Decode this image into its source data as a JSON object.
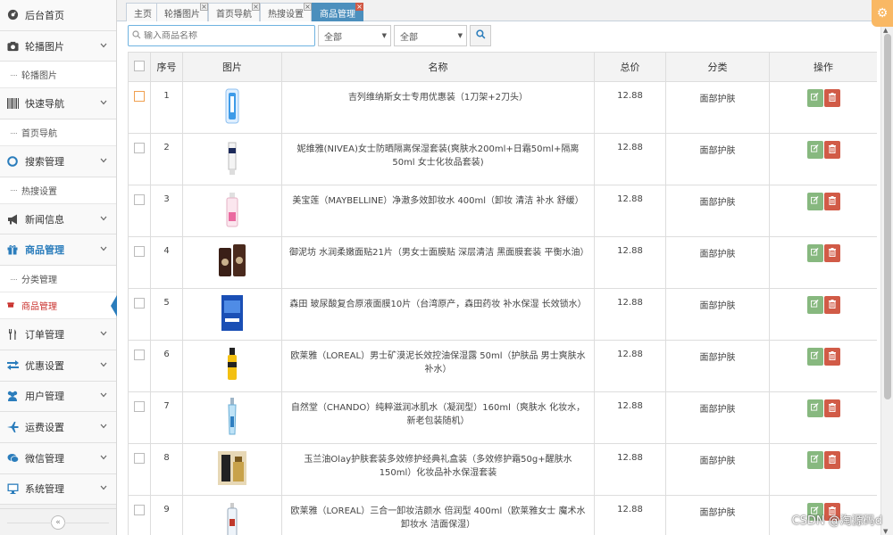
{
  "sidebar": {
    "items": [
      {
        "label": "后台首页",
        "icon": "dashboard-icon",
        "expandable": false
      },
      {
        "label": "轮播图片",
        "icon": "camera-icon",
        "expandable": true
      },
      {
        "sub": "轮播图片"
      },
      {
        "label": "快速导航",
        "icon": "barcode-icon",
        "expandable": true
      },
      {
        "sub": "首页导航"
      },
      {
        "label": "搜索管理",
        "icon": "circle-icon",
        "expandable": true
      },
      {
        "sub": "热搜设置"
      },
      {
        "label": "新闻信息",
        "icon": "megaphone-icon",
        "expandable": true
      },
      {
        "label": "商品管理",
        "icon": "gift-icon",
        "expandable": true,
        "active": true
      },
      {
        "sub": "分类管理"
      },
      {
        "sub": "商品管理",
        "active": true
      },
      {
        "label": "订单管理",
        "icon": "cutlery-icon",
        "expandable": true
      },
      {
        "label": "优惠设置",
        "icon": "exchange-icon",
        "expandable": true
      },
      {
        "label": "用户管理",
        "icon": "users-icon",
        "expandable": true
      },
      {
        "label": "运费设置",
        "icon": "plane-icon",
        "expandable": true
      },
      {
        "label": "微信管理",
        "icon": "chat-icon",
        "expandable": true
      },
      {
        "label": "系统管理",
        "icon": "monitor-icon",
        "expandable": true
      }
    ]
  },
  "tabs": [
    "主页",
    "轮播图片",
    "首页导航",
    "热搜设置",
    "商品管理"
  ],
  "toolbar": {
    "search_placeholder": "输入商品名称",
    "select1": "全部",
    "select2": "全部"
  },
  "table": {
    "headers": [
      "",
      "序号",
      "图片",
      "名称",
      "总价",
      "分类",
      "操作"
    ],
    "rows": [
      {
        "no": "1",
        "name": "吉列维纳斯女士专用优惠装（1刀架+2刀头）",
        "price": "12.88",
        "category": "面部护肤",
        "thumb": "razor"
      },
      {
        "no": "2",
        "name": "妮维雅(NIVEA)女士防晒隔离保湿套装(爽肤水200ml+日霜50ml+隔离50ml 女士化妆品套装)",
        "price": "12.88",
        "category": "面部护肤",
        "thumb": "tube"
      },
      {
        "no": "3",
        "name": "美宝莲（MAYBELLINE）净澈多效卸妆水 400ml（卸妆 清洁 补水 舒缓）",
        "price": "12.88",
        "category": "面部护肤",
        "thumb": "bottle-pink"
      },
      {
        "no": "4",
        "name": "御泥坊 水润柔嫩面贴21片（男女士面膜贴 深层清洁 黑面膜套装 平衡水油）",
        "price": "12.88",
        "category": "面部护肤",
        "thumb": "jars"
      },
      {
        "no": "5",
        "name": "森田 玻尿酸复合原液面膜10片（台湾原产，森田药妆 补水保湿 长效锁水）",
        "price": "12.88",
        "category": "面部护肤",
        "thumb": "box-blue"
      },
      {
        "no": "6",
        "name": "欧莱雅（LOREAL）男士矿漠泥长效控油保湿露 50ml（护肤品 男士爽肤水 补水）",
        "price": "12.88",
        "category": "面部护肤",
        "thumb": "bottle-yellow"
      },
      {
        "no": "7",
        "name": "自然堂（CHANDO）纯粹滋润冰肌水（凝润型）160ml（爽肤水 化妆水，新老包装随机）",
        "price": "12.88",
        "category": "面部护肤",
        "thumb": "bottle-blue"
      },
      {
        "no": "8",
        "name": "玉兰油Olay护肤套装多效修护经典礼盒装（多效修护霜50g+醒肤水150ml）化妆品补水保湿套装",
        "price": "12.88",
        "category": "面部护肤",
        "thumb": "giftset"
      },
      {
        "no": "9",
        "name": "欧莱雅（LOREAL）三合一卸妆洁颜水 倍润型 400ml（欧莱雅女士 魔术水 卸妆水 洁面保湿）",
        "price": "12.88",
        "category": "面部护肤",
        "thumb": "bottle-clear"
      }
    ]
  },
  "watermark": "CSDN @淘源码d",
  "colors": {
    "accent": "#4c8fbd",
    "edit": "#87b87f",
    "delete": "#d15b47",
    "gear": "#f9b864"
  }
}
